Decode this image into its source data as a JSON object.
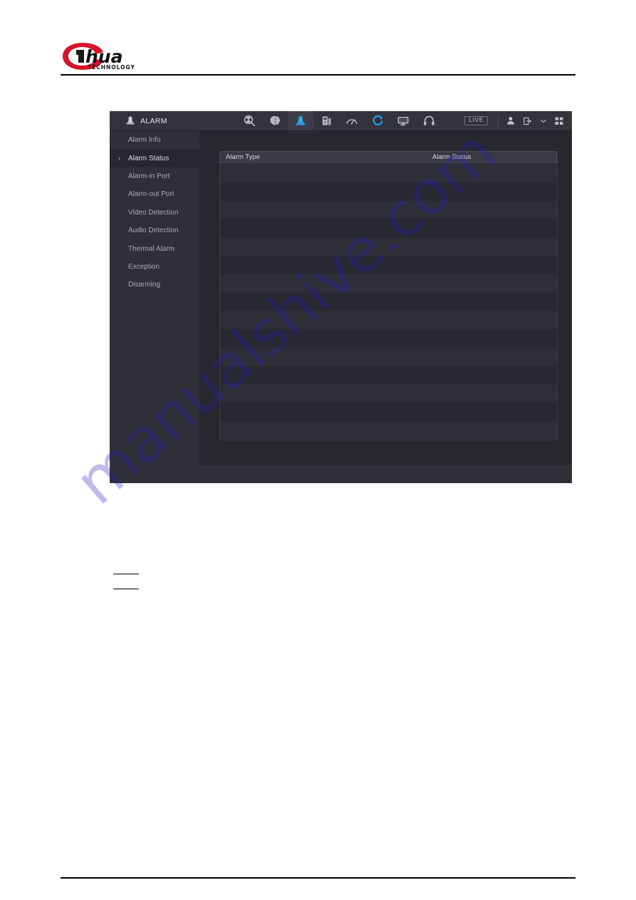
{
  "document": {
    "brand_name": "alhua",
    "brand_tagline": "TECHNOLOGY",
    "watermark": "manualshive.com"
  },
  "device_ui": {
    "window_title": "ALARM",
    "title_icon": "alarm-bell-icon",
    "nav_icons": [
      {
        "name": "ai-search-icon",
        "active": false
      },
      {
        "name": "ai-brain-icon",
        "active": false
      },
      {
        "name": "alarm-bell-icon",
        "active": true
      },
      {
        "name": "storage-icon",
        "active": false
      },
      {
        "name": "network-gauge-icon",
        "active": false
      },
      {
        "name": "maintenance-refresh-icon",
        "active": false
      },
      {
        "name": "display-monitor-icon",
        "active": false
      },
      {
        "name": "audio-headset-icon",
        "active": false
      }
    ],
    "right_controls": {
      "live_label": "LIVE",
      "user_icon": "user-account-icon",
      "logout_icon": "logout-icon",
      "logout_chevron": "chevron-down-icon",
      "grid_icon": "qr-grid-icon"
    },
    "sidebar": {
      "items": [
        {
          "label": "Alarm Info",
          "active": false
        },
        {
          "label": "Alarm Status",
          "active": true,
          "chevron": "›"
        },
        {
          "label": "Alarm-in Port",
          "active": false
        },
        {
          "label": "Alarm-out Port",
          "active": false
        },
        {
          "label": "Video Detection",
          "active": false
        },
        {
          "label": "Audio Detection",
          "active": false
        },
        {
          "label": "Thermal Alarm",
          "active": false
        },
        {
          "label": "Exception",
          "active": false
        },
        {
          "label": "Disarming",
          "active": false
        }
      ]
    },
    "table": {
      "columns": [
        {
          "key": "alarm_type",
          "label": "Alarm Type"
        },
        {
          "key": "alarm_status",
          "label": "Alarm Status"
        }
      ],
      "rows": [
        {
          "alarm_type": "",
          "alarm_status": ""
        },
        {
          "alarm_type": "",
          "alarm_status": ""
        },
        {
          "alarm_type": "",
          "alarm_status": ""
        },
        {
          "alarm_type": "",
          "alarm_status": ""
        },
        {
          "alarm_type": "",
          "alarm_status": ""
        },
        {
          "alarm_type": "",
          "alarm_status": ""
        },
        {
          "alarm_type": "",
          "alarm_status": ""
        },
        {
          "alarm_type": "",
          "alarm_status": ""
        },
        {
          "alarm_type": "",
          "alarm_status": ""
        },
        {
          "alarm_type": "",
          "alarm_status": ""
        },
        {
          "alarm_type": "",
          "alarm_status": ""
        },
        {
          "alarm_type": "",
          "alarm_status": ""
        },
        {
          "alarm_type": "",
          "alarm_status": ""
        },
        {
          "alarm_type": "",
          "alarm_status": ""
        },
        {
          "alarm_type": "",
          "alarm_status": ""
        }
      ]
    },
    "colors": {
      "window_bg": "#27272e",
      "topbar_bg": "#33333c",
      "sidebar_bg": "#2f2f38",
      "accent_blue": "#2b9ae8",
      "text_primary": "#dcdde2",
      "text_secondary": "#a9aab3"
    }
  }
}
